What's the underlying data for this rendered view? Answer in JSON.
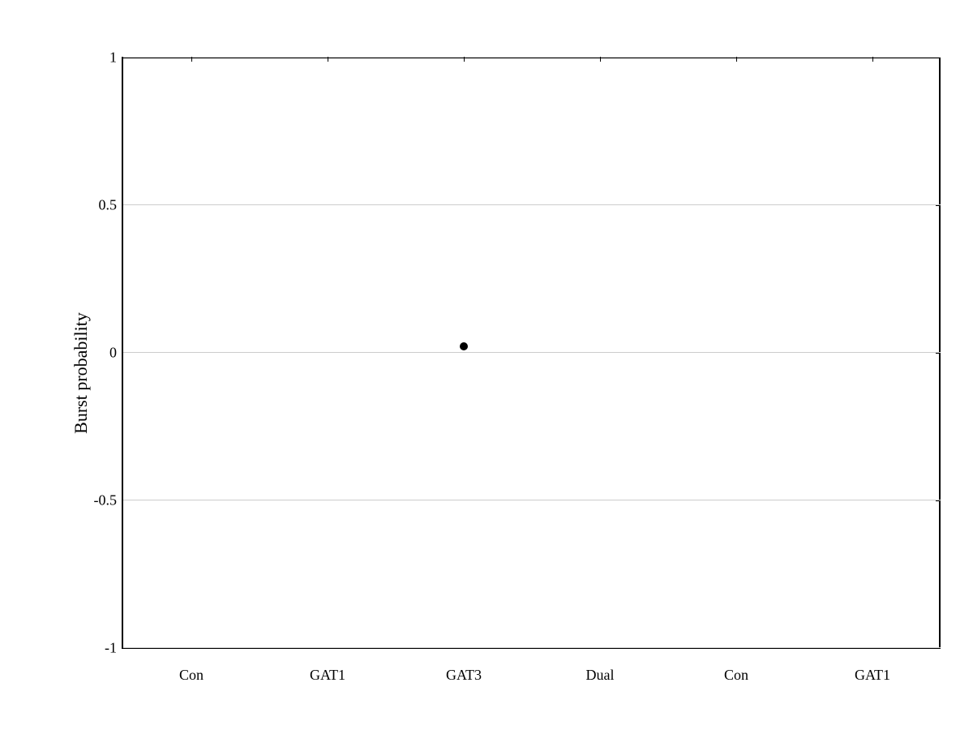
{
  "chart": {
    "y_axis_label": "Burst probability",
    "y_ticks": [
      {
        "value": 1,
        "label": "1"
      },
      {
        "value": 0.5,
        "label": "0.5"
      },
      {
        "value": 0,
        "label": "0"
      },
      {
        "value": -0.5,
        "label": "-0.5"
      },
      {
        "value": -1,
        "label": "-1"
      }
    ],
    "x_ticks": [
      {
        "label": "Con",
        "position": 0
      },
      {
        "label": "GAT1",
        "position": 1
      },
      {
        "label": "GAT3",
        "position": 2
      },
      {
        "label": "Dual",
        "position": 3
      },
      {
        "label": "Con",
        "position": 4
      },
      {
        "label": "GAT1",
        "position": 5
      }
    ],
    "data_points": [
      {
        "x_index": 2,
        "y_value": 0.02
      }
    ]
  }
}
